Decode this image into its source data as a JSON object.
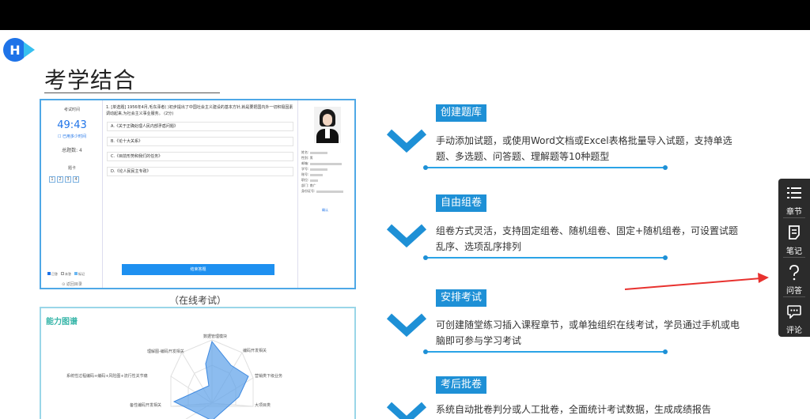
{
  "heading": {
    "badge": "H",
    "title": "考学结合"
  },
  "exam": {
    "left": {
      "label": "考试时间",
      "time": "49:43",
      "sub": "☐ 已用多少时间",
      "total": "总题数: 4",
      "answer_card": "题卡",
      "numbers": [
        "1",
        "2",
        "3",
        "4"
      ],
      "legend": [
        "已答",
        "未答",
        "标记"
      ],
      "back": "⊙ 返回目录"
    },
    "question": "1. [单选题] 1956年4月,毛东泽者(  )初步提出了中国社会主义建设的基本方针,就是要把国内外一切积极因素调动起来,为社会主义事业服务。 (2分)",
    "options": [
      "A.《关于正确处理人民内部矛盾问题》",
      "B.《论十大关系》",
      "C.《目前形势和我们的任务》",
      "D.《论人民民主专政》"
    ],
    "submit": "结束答题",
    "info": [
      {
        "k": "姓名",
        "v": ""
      },
      {
        "k": "性别",
        "v": "男"
      },
      {
        "k": "邮箱",
        "v": ""
      },
      {
        "k": "学号",
        "v": ""
      },
      {
        "k": "账号",
        "v": ""
      },
      {
        "k": "职位",
        "v": ""
      },
      {
        "k": "部门",
        "v": "南广"
      },
      {
        "k": "身份证号",
        "v": ""
      }
    ],
    "confirm": "确认"
  },
  "caption_exam": "（在线考试）",
  "ability_chart": {
    "title": "能力图谱",
    "labels": [
      "数据管理模块",
      "编码开发相关",
      "营销类下级业务",
      "大项目类",
      "",
      "备性编码开发相关",
      "系统性过程编码+编码+风险图+流行性关节痛",
      "理解图-编码开发相关"
    ]
  },
  "features": [
    {
      "title": "创建题库",
      "desc": "手动添加试题，或使用Word文档或Excel表格批量导入试题，支持单选题、多选题、问答题、理解题等10种题型"
    },
    {
      "title": "自由组卷",
      "desc": "组卷方式灵活，支持固定组卷、随机组卷、固定+随机组卷，可设置试题乱序、选项乱序排列"
    },
    {
      "title": "安排考试",
      "desc": "可创建随堂练习插入课程章节，或单独组织在线考试，学员通过手机或电脑即可参与学习考试"
    },
    {
      "title": "考后批卷",
      "desc": "系统自动批卷判分或人工批卷，全面统计考试数据，生成成绩报告"
    }
  ],
  "sidebar": [
    {
      "icon": "list-icon",
      "label": "章节"
    },
    {
      "icon": "note-icon",
      "label": "笔记"
    },
    {
      "icon": "question-icon",
      "label": "问答"
    },
    {
      "icon": "comment-icon",
      "label": "评论"
    }
  ],
  "colors": {
    "accent": "#1e90d6",
    "badge": "#1e73e8",
    "pointer": "#e8322f",
    "sidebar": "#2b2b2b"
  }
}
